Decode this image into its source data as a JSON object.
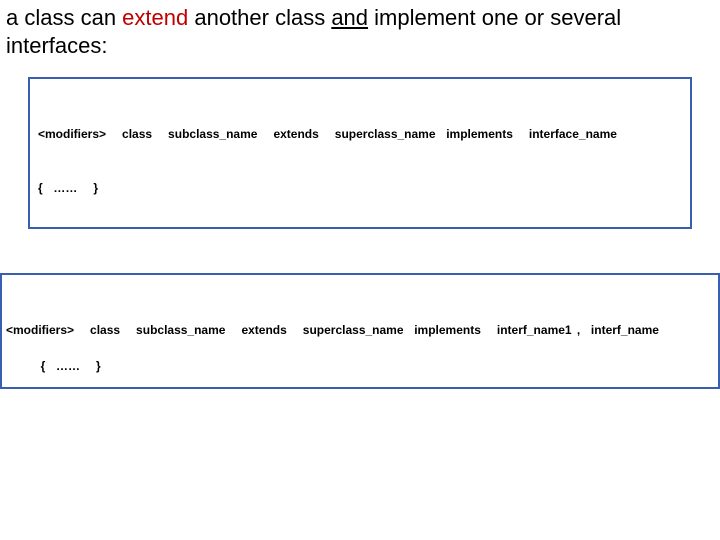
{
  "heading": {
    "pre": "a class can ",
    "extend": "extend",
    "mid1": " another class ",
    "and": "and",
    "mid2": " implement one or several interfaces:"
  },
  "box1": {
    "line1": "<modifiers>   class   subclass_name   extends   superclass_name  implements   interface_name",
    "line2": "{  ……   }"
  },
  "box2": {
    "line1": "<modifiers>   class   subclass_name   extends   superclass_name  implements   interf_name1 ,  interf_name",
    "line2": "{  ……   }"
  }
}
